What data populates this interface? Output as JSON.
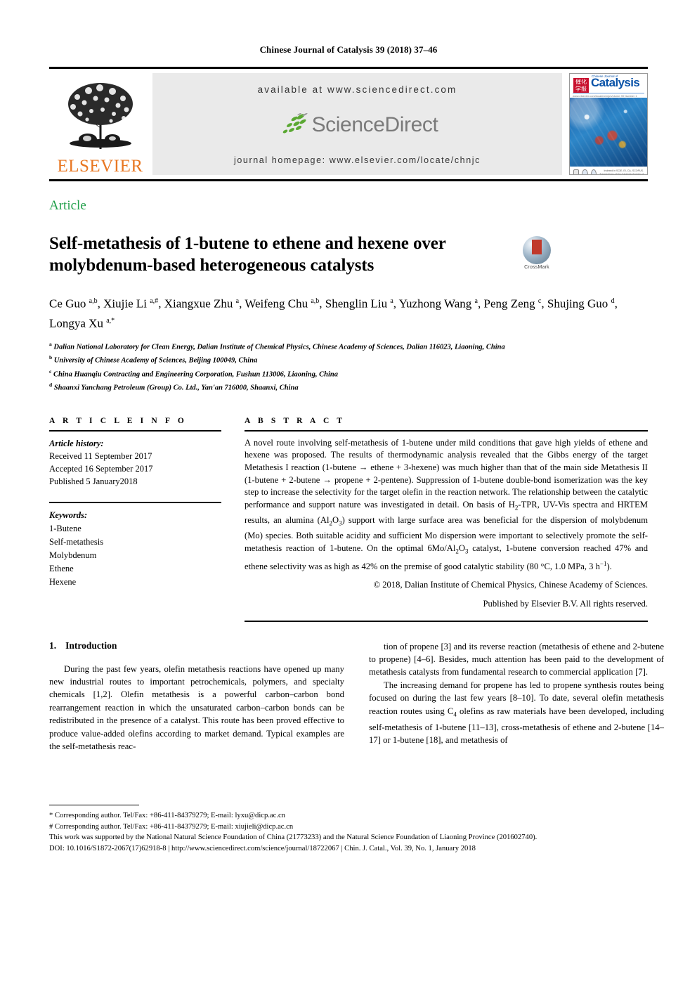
{
  "running_head": "Chinese Journal of Catalysis 39 (2018) 37–46",
  "masthead": {
    "publisher_name": "ELSEVIER",
    "available_at": "available at www.sciencedirect.com",
    "sciencedirect_wordmark": "ScienceDirect",
    "journal_homepage": "journal homepage: www.elsevier.com/locate/chnjc",
    "cover": {
      "journal_name": "Catalysis",
      "journal_superline": "Chinese Journal of",
      "cover_rule_left": "www.elsevier.com/locate/chnjc",
      "cover_rule_right": "Volume 39  Number 1  January 2018",
      "cover_footer": "Indexed in SCIE, EI, CA, SCOPUS. Transactions of the Catalysis Society of China"
    }
  },
  "article_type": "Article",
  "title": "Self-metathesis of 1-butene to ethene and hexene over molybdenum-based heterogeneous catalysts",
  "crossmark_label": "CrossMark",
  "authors_html": "Ce Guo <sup>a,b</sup>, Xiujie Li <sup>a,#</sup>, Xiangxue Zhu <sup>a</sup>, Weifeng Chu <sup>a,b</sup>, Shenglin Liu <sup>a</sup>, Yuzhong Wang <sup>a</sup>, Peng Zeng <sup>c</sup>, Shujing Guo <sup>d</sup>, Longya Xu <sup>a,*</sup>",
  "affiliations": [
    {
      "mark": "a",
      "text": "Dalian National Laboratory for Clean Energy, Dalian Institute of Chemical Physics, Chinese Academy of Sciences, Dalian 116023, Liaoning, China"
    },
    {
      "mark": "b",
      "text": "University of Chinese Academy of Sciences, Beijing 100049, China"
    },
    {
      "mark": "c",
      "text": "China Huanqiu Contracting and Engineering Corporation, Fushun 113006, Liaoning, China"
    },
    {
      "mark": "d",
      "text": "Shaanxi Yanchang Petroleum (Group) Co. Ltd., Yan'an 716000, Shaanxi, China"
    }
  ],
  "article_info": {
    "heading": "A R T I C L E   I N F O",
    "history_label": "Article history:",
    "history": [
      "Received 11 September 2017",
      "Accepted 16 September 2017",
      "Published 5 January2018"
    ],
    "keywords_label": "Keywords:",
    "keywords": [
      "1-Butene",
      "Self-metathesis",
      "Molybdenum",
      "Ethene",
      "Hexene"
    ]
  },
  "abstract": {
    "heading": "A B S T R A C T",
    "body_html": "A novel route involving self-metathesis of 1-butene under mild conditions that gave high yields of ethene and hexene was proposed. The results of thermodynamic analysis revealed that the Gibbs energy of the target Metathesis I reaction (1-butene &rarr; ethene + 3-hexene) was much higher than that of the main side Metathesis II (1-butene + 2-butene &rarr; propene + 2-pentene). Suppression of 1-butene double-bond isomerization was the key step to increase the selectivity for the target olefin in the reaction network. The relationship between the catalytic performance and support nature was investigated in detail. On basis of H<sub>2</sub>-TPR, UV-Vis spectra and HRTEM results, an alumina (Al<sub>2</sub>O<sub>3</sub>) support with large surface area was beneficial for the dispersion of molybdenum (Mo) species. Both suitable acidity and sufficient Mo dispersion were important to selectively promote the self-metathesis reaction of 1-butene. On the optimal 6Mo/Al<sub>2</sub>O<sub>3</sub> catalyst, 1-butene conversion reached 47% and ethene selectivity was as high as 42% on the premise of good catalytic stability (80 &deg;C, 1.0 MPa, 3 h<sup>&minus;1</sup>).",
    "copyright_line1": "© 2018, Dalian Institute of Chemical Physics, Chinese Academy of Sciences.",
    "copyright_line2": "Published by Elsevier B.V. All rights reserved."
  },
  "introduction": {
    "number": "1.",
    "heading": "Introduction",
    "left_paragraph_html": "During the past few years, olefin metathesis reactions have opened up many new industrial routes to important petrochemicals, polymers, and specialty chemicals [1,2]. Olefin metathesis is a powerful carbon&ndash;carbon bond rearrangement reaction in which the unsaturated carbon&ndash;carbon bonds can be redistributed in the presence of a catalyst. This route has been proved effective to produce value-added olefins according to market demand. Typical examples are the self-metathesis reac-",
    "right_paragraph1_html": "tion of propene [3] and its reverse reaction (metathesis of ethene and 2-butene to propene) [4&ndash;6]. Besides, much attention has been paid to the development of metathesis catalysts from fundamental research to commercial application [7].",
    "right_paragraph2_html": "The increasing demand for propene has led to propene synthesis routes being focused on during the last few years [8&ndash;10]. To date, several olefin metathesis reaction routes using C<sub>4</sub> olefins as raw materials have been developed, including self-metathesis of 1-butene [11&ndash;13], cross-metathesis of ethene and 2-butene [14&ndash;17] or 1-butene [18], and metathesis of"
  },
  "footnotes": {
    "corresponding_1_html": "* Corresponding author. Tel/Fax: +86-411-84379279; E-mail: lyxu@dicp.ac.cn",
    "corresponding_2_html": "# Corresponding author. Tel/Fax: +86-411-84379279; E-mail: xiujieli@dicp.ac.cn",
    "funding": "This work was supported by the National Natural Science Foundation of China (21773233) and the Natural Science Foundation of Liaoning Province (201602740).",
    "doi_line": "DOI: 10.1016/S1872-2067(17)62918-8 | http://www.sciencedirect.com/science/journal/18722067 | Chin. J. Catal., Vol. 39, No. 1, January 2018"
  },
  "colors": {
    "elsevier_orange": "#E87722",
    "article_green": "#22a04b",
    "sciencedirect_gray": "#7a7a7a",
    "band_gray": "#eaeaea"
  }
}
